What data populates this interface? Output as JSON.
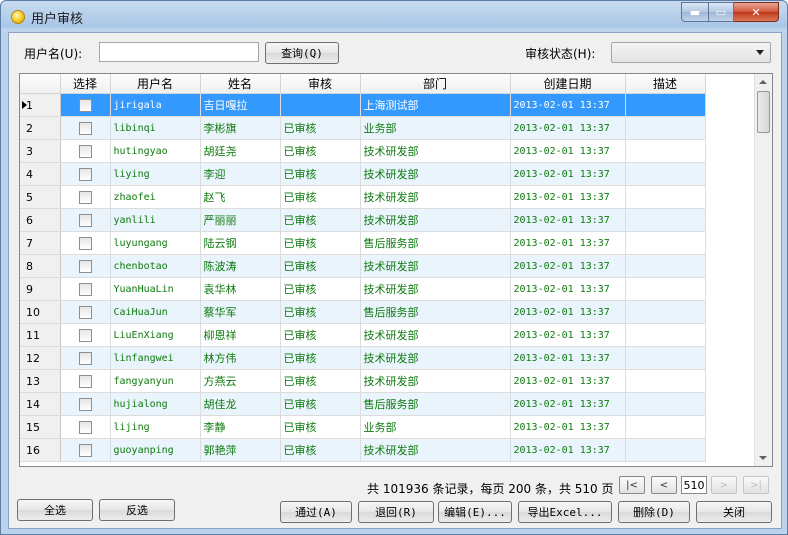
{
  "window": {
    "title": "用户审核",
    "controls": {
      "minimize": "▬",
      "maximize": "▭",
      "close": "✕"
    }
  },
  "search": {
    "username_label": "用户名(U):",
    "username_value": "",
    "query_button": "查询(Q)",
    "status_label": "审核状态(H):",
    "status_value": ""
  },
  "grid": {
    "columns": [
      "选择",
      "用户名",
      "姓名",
      "审核",
      "部门",
      "创建日期",
      "描述"
    ],
    "rows": [
      {
        "no": "1",
        "username": "jirigala",
        "name": "吉日嘎拉",
        "audit": "",
        "dept": "上海测试部",
        "date": "2013-02-01 13:37",
        "desc": "",
        "selected": true
      },
      {
        "no": "2",
        "username": "libinqi",
        "name": "李彬旗",
        "audit": "已审核",
        "dept": "业务部",
        "date": "2013-02-01 13:37",
        "desc": ""
      },
      {
        "no": "3",
        "username": "hutingyao",
        "name": "胡廷尧",
        "audit": "已审核",
        "dept": "技术研发部",
        "date": "2013-02-01 13:37",
        "desc": ""
      },
      {
        "no": "4",
        "username": "liying",
        "name": "李迎",
        "audit": "已审核",
        "dept": "技术研发部",
        "date": "2013-02-01 13:37",
        "desc": ""
      },
      {
        "no": "5",
        "username": "zhaofei",
        "name": "赵飞",
        "audit": "已审核",
        "dept": "技术研发部",
        "date": "2013-02-01 13:37",
        "desc": ""
      },
      {
        "no": "6",
        "username": "yanlili",
        "name": "严丽丽",
        "audit": "已审核",
        "dept": "技术研发部",
        "date": "2013-02-01 13:37",
        "desc": ""
      },
      {
        "no": "7",
        "username": "luyungang",
        "name": "陆云钢",
        "audit": "已审核",
        "dept": "售后服务部",
        "date": "2013-02-01 13:37",
        "desc": ""
      },
      {
        "no": "8",
        "username": "chenbotao",
        "name": "陈波涛",
        "audit": "已审核",
        "dept": "技术研发部",
        "date": "2013-02-01 13:37",
        "desc": ""
      },
      {
        "no": "9",
        "username": "YuanHuaLin",
        "name": "袁华林",
        "audit": "已审核",
        "dept": "技术研发部",
        "date": "2013-02-01 13:37",
        "desc": ""
      },
      {
        "no": "10",
        "username": "CaiHuaJun",
        "name": "蔡华军",
        "audit": "已审核",
        "dept": "售后服务部",
        "date": "2013-02-01 13:37",
        "desc": ""
      },
      {
        "no": "11",
        "username": "LiuEnXiang",
        "name": "柳恩祥",
        "audit": "已审核",
        "dept": "技术研发部",
        "date": "2013-02-01 13:37",
        "desc": ""
      },
      {
        "no": "12",
        "username": "linfangwei",
        "name": "林方伟",
        "audit": "已审核",
        "dept": "技术研发部",
        "date": "2013-02-01 13:37",
        "desc": ""
      },
      {
        "no": "13",
        "username": "fangyanyun",
        "name": "方燕云",
        "audit": "已审核",
        "dept": "技术研发部",
        "date": "2013-02-01 13:37",
        "desc": ""
      },
      {
        "no": "14",
        "username": "hujialong",
        "name": "胡佳龙",
        "audit": "已审核",
        "dept": "售后服务部",
        "date": "2013-02-01 13:37",
        "desc": ""
      },
      {
        "no": "15",
        "username": "lijing",
        "name": "李静",
        "audit": "已审核",
        "dept": "业务部",
        "date": "2013-02-01 13:37",
        "desc": ""
      },
      {
        "no": "16",
        "username": "guoyanping",
        "name": "郭艳萍",
        "audit": "已审核",
        "dept": "技术研发部",
        "date": "2013-02-01 13:37",
        "desc": ""
      }
    ]
  },
  "pager": {
    "summary": "共 101936 条记录，每页 200 条，共 510 页",
    "first": "|<",
    "prev": "<",
    "page": "510",
    "next": ">",
    "last": ">|"
  },
  "buttons": {
    "select_all": "全选",
    "invert": "反选",
    "approve": "通过(A)",
    "reject": "退回(R)",
    "edit": "编辑(E)...",
    "export": "导出Excel...",
    "delete": "删除(D)",
    "close": "关闭"
  }
}
